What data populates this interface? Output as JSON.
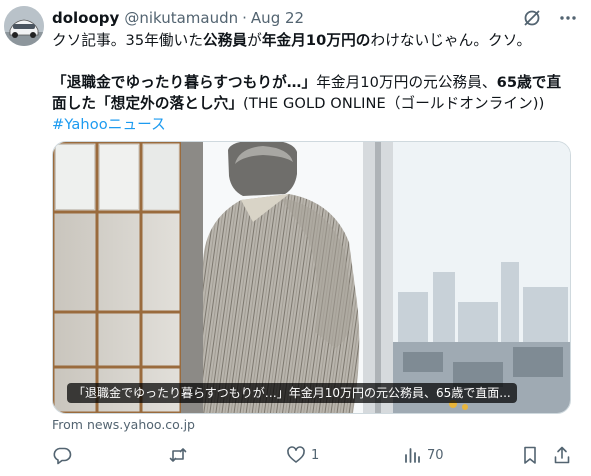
{
  "tweet": {
    "display_name": "doloopy",
    "handle": "@nikutamaudn",
    "separator": "·",
    "date": "Aug 22",
    "line1_prefix": "クソ記事。35年働いた",
    "line1_bold": "公務員",
    "line1_mid": "が",
    "line1_bold2": "年金月10万円",
    "line1_bold3": "の",
    "line1_suffix": "わけないじゃん。クソ。",
    "line2_bold": "「退職金でゆったり暮らすつもりが…」",
    "line2_rest": "年金月10万円の元公務員、",
    "line2_bold2": "65歳で直",
    "line3_bold": "面した「想定外の落とし穴」",
    "line3_rest": "(THE GOLD ONLINE（ゴールドオンライン))",
    "hashtag": "#Yahooニュース"
  },
  "card": {
    "caption": "「退職金でゆったり暮らすつもりが…」年金月10万円の元公務員、65歳で直面...",
    "source": "From news.yahoo.co.jp"
  },
  "actions": {
    "reply_count": "",
    "retweet_count": "",
    "like_count": "1",
    "views_count": "70"
  },
  "icons": {
    "top": [
      "grok-slash-icon",
      "more-icon"
    ],
    "actions": [
      "reply-icon",
      "retweet-icon",
      "like-icon",
      "views-icon",
      "bookmark-icon",
      "share-icon"
    ]
  },
  "colors": {
    "text": "#0f1419",
    "secondary": "#536471",
    "link": "#1d9bf0"
  }
}
